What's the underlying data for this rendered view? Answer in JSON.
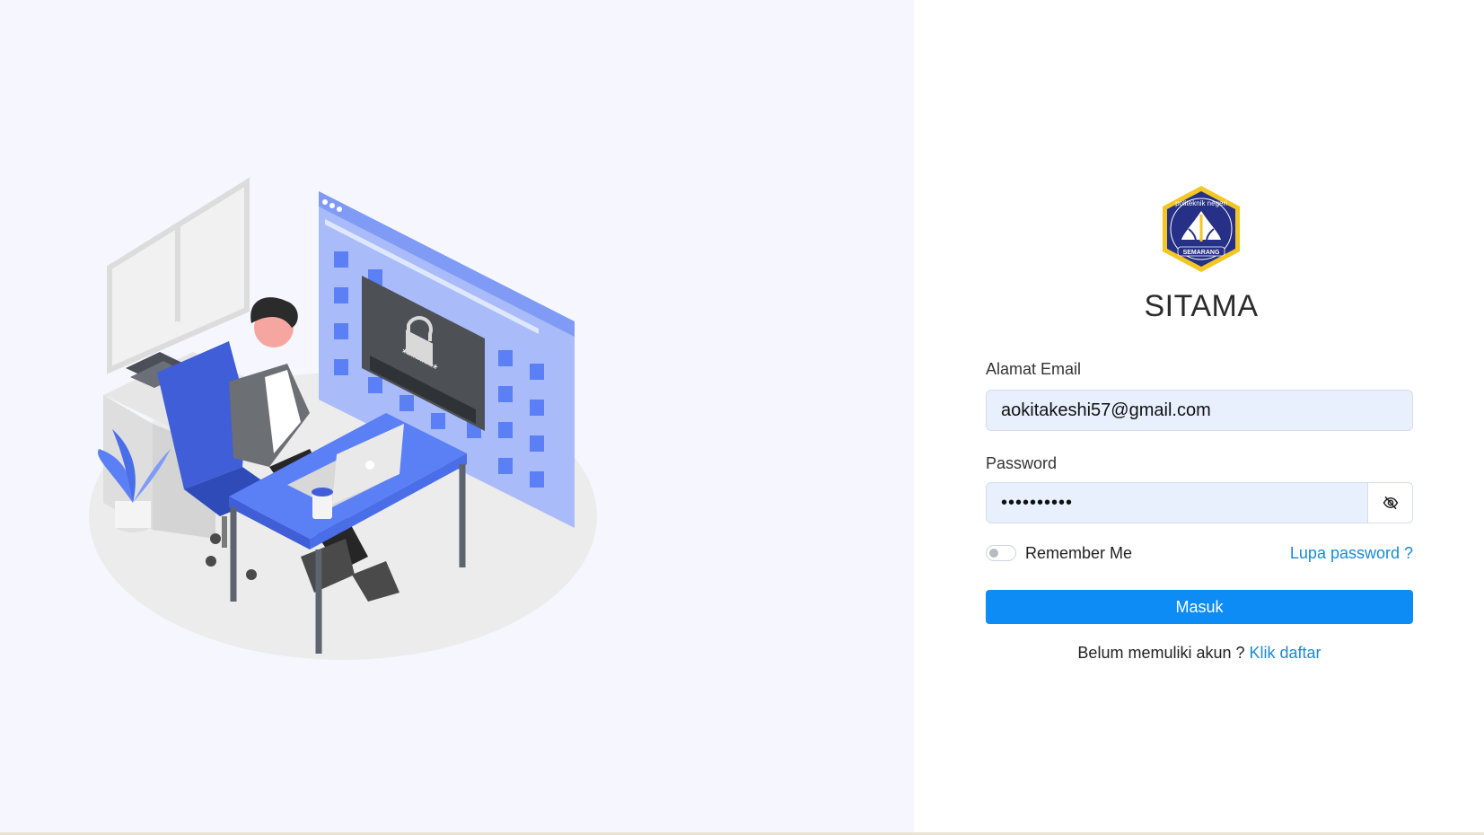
{
  "app": {
    "title": "SITAMA",
    "logo": {
      "top_text": "politeknik negeri",
      "bottom_text": "SEMARANG"
    }
  },
  "login_form": {
    "email_label": "Alamat Email",
    "email_value": "aokitakeshi57@gmail.com",
    "password_label": "Password",
    "password_value": "••••••••••",
    "remember_label": "Remember Me",
    "remember_checked": false,
    "forgot_label": "Lupa password ?",
    "submit_label": "Masuk",
    "register_prompt": "Belum memuliki akun ?",
    "register_link": "Klik daftar"
  },
  "illustration": {
    "password_prompt": "********"
  },
  "colors": {
    "accent": "#0d8cf5",
    "link": "#1a8ad4",
    "input_bg": "#e8f0fe",
    "illustration_blue": "#5b7ff5",
    "left_bg": "#f6f7fe"
  },
  "icons": {
    "password_toggle": "eye-slash-icon"
  }
}
